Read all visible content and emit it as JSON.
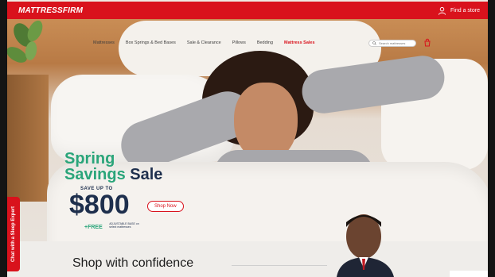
{
  "header": {
    "logo": "MATTRESSFIRM",
    "find_store": "Find a store"
  },
  "nav": {
    "items": [
      "Mattresses",
      "Box Springs & Bed Bases",
      "Sale & Clearance",
      "Pillows",
      "Bedding"
    ],
    "sale_item": "Mattress Sales",
    "search_placeholder": "Search mattresses"
  },
  "promo": {
    "line1": "Spring",
    "line2_green": "Savings",
    "line2_navy": "Sale",
    "save_up": "SAVE UP TO",
    "amount": "$800",
    "free": "+FREE",
    "free_sub": "ADJUSTABLE BASE on select mattresses",
    "cta": "Shop Now"
  },
  "chat": {
    "label": "Chat with a Sleep Expert"
  },
  "confidence": {
    "title": "Shop with confidence"
  },
  "colors": {
    "brand_red": "#d9121c",
    "navy": "#1e2f4d",
    "green": "#2aa57a"
  }
}
